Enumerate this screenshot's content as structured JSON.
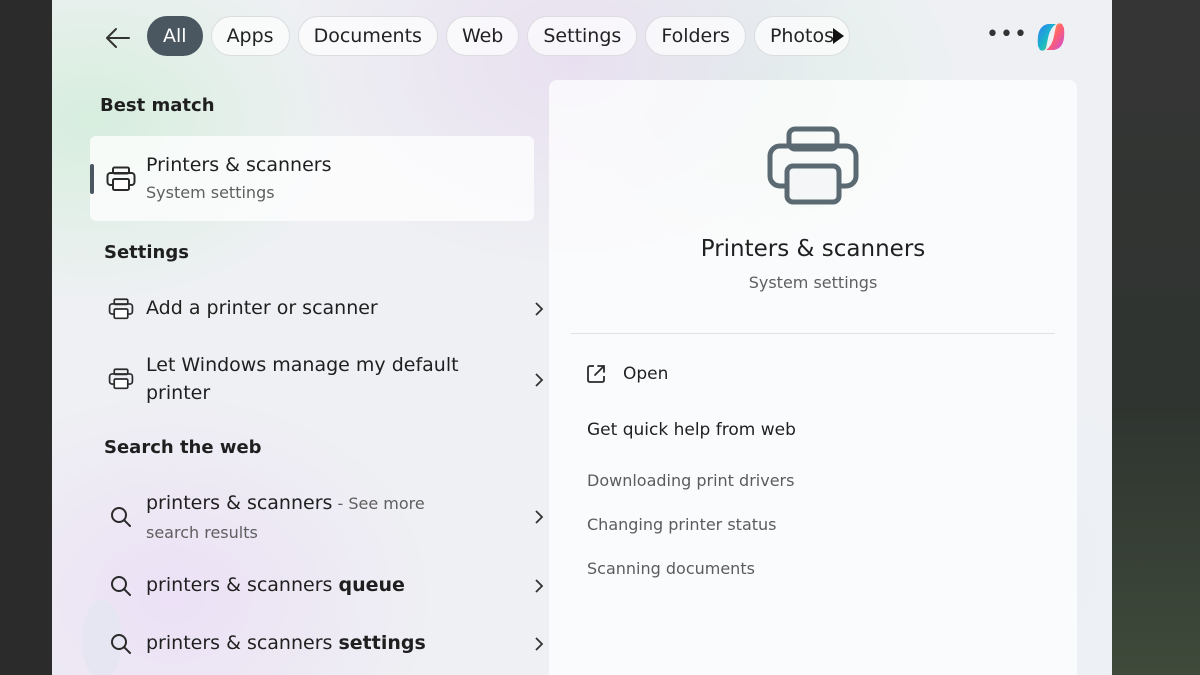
{
  "topbar": {
    "tabs": [
      {
        "label": "All",
        "active": true
      },
      {
        "label": "Apps"
      },
      {
        "label": "Documents"
      },
      {
        "label": "Web"
      },
      {
        "label": "Settings"
      },
      {
        "label": "Folders"
      },
      {
        "label": "Photos"
      }
    ],
    "icons": [
      "back-arrow-icon",
      "play-icon",
      "more-icon",
      "copilot-icon"
    ]
  },
  "best_match": {
    "heading": "Best match",
    "title": "Printers & scanners",
    "subtitle": "System settings",
    "icon": "printer-icon"
  },
  "settings": {
    "heading": "Settings",
    "items": [
      {
        "label": "Add a printer or scanner",
        "icon": "printer-icon"
      },
      {
        "label_line1": "Let Windows manage my default",
        "label_line2": "printer",
        "icon": "printer-icon"
      }
    ]
  },
  "web": {
    "heading": "Search the web",
    "items": [
      {
        "query": "printers & scanners",
        "suffix": " - See more",
        "line2": "search results",
        "icon": "search-icon"
      },
      {
        "query": "printers & scanners",
        "bold": "queue",
        "icon": "search-icon"
      },
      {
        "query": "printers & scanners",
        "bold": "settings",
        "icon": "search-icon"
      }
    ]
  },
  "detail": {
    "title": "Printers & scanners",
    "subtitle": "System settings",
    "open_label": "Open",
    "help_heading": "Get quick help from web",
    "help_links": [
      "Downloading print drivers",
      "Changing printer status",
      "Scanning documents"
    ]
  },
  "colors": {
    "accent": "#4a5761",
    "icon": "#5b6a72"
  }
}
